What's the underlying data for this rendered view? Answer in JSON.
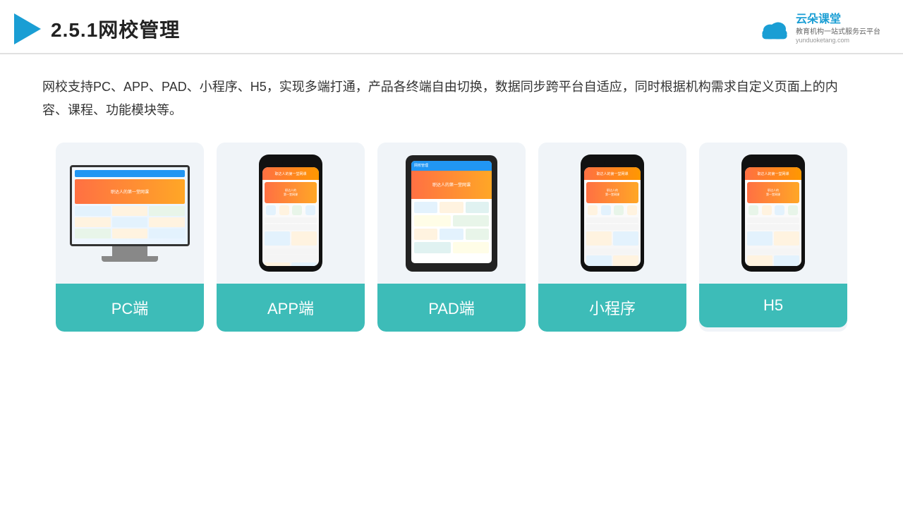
{
  "header": {
    "title": "2.5.1网校管理",
    "brand": {
      "name": "云朵课堂",
      "url": "yunduoketang.com",
      "tagline1": "教育机构一站",
      "tagline2": "式服务云平台"
    }
  },
  "description": {
    "text": "网校支持PC、APP、PAD、小程序、H5，实现多端打通，产品各终端自由切换，数据同步跨平台自适应，同时根据机构需求自定义页面上的内容、课程、功能模块等。"
  },
  "cards": [
    {
      "id": "pc",
      "label": "PC端"
    },
    {
      "id": "app",
      "label": "APP端"
    },
    {
      "id": "pad",
      "label": "PAD端"
    },
    {
      "id": "miniprogram",
      "label": "小程序"
    },
    {
      "id": "h5",
      "label": "H5"
    }
  ],
  "colors": {
    "accent": "#3dbcb8",
    "header_line": "#e0e0e0",
    "title_color": "#1a9ed4"
  }
}
